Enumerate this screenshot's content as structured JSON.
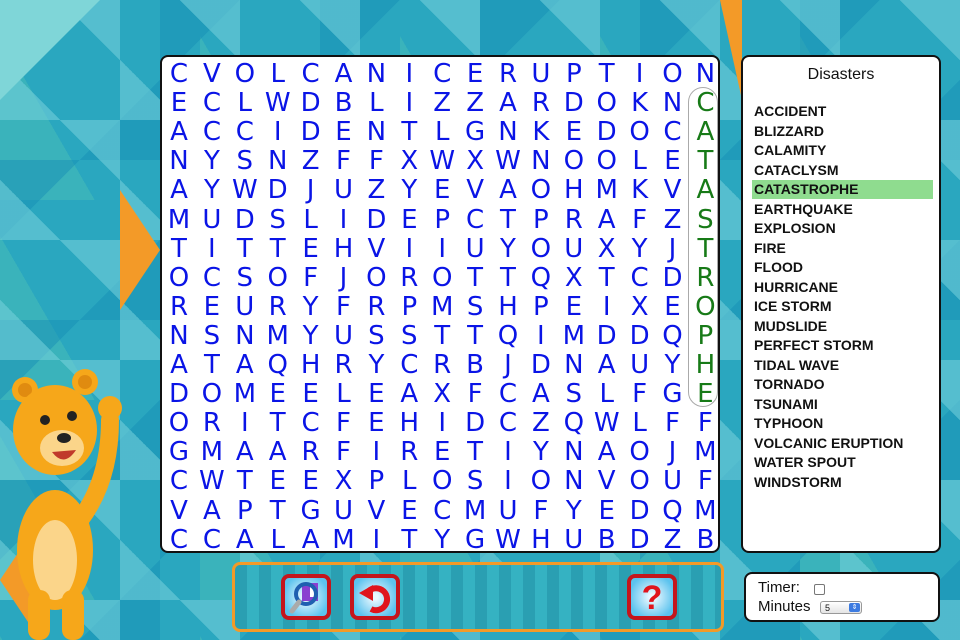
{
  "grid": {
    "rows": [
      "CVOLCANICERUPTION",
      "ECLWDBLIZZARDOKNC",
      "ACCIDENTLGNKEDOCA",
      "NYSNZFFXWXWNOOLET",
      "AYWDJUZYEVAOHMKVA",
      "MUDSLIDEPCTPRAFZS",
      "TITTEHVIIUYOUXYJT",
      "OCSOFJOROTTQXTCDR",
      "REURYFRPMSHPEIXEO",
      "NSNMYUSSTTQIMDDQP",
      "ATAQHRYCRBJDNAUYH",
      "DOMEELEAXFCASLFGE",
      "ORITCFEHIDCZQWLFF",
      "GMAARFIRETIYNAOJM",
      "CWTEEXPLOSIONVOUF",
      "VAPTGUVECMUFYEDQM",
      "CCALAMITYGWHUBDZB"
    ],
    "found_word": "CATASTROPHE",
    "found_color": "#177a17",
    "letter_color": "#0a14e6"
  },
  "word_list": {
    "title": "Disasters",
    "items": [
      {
        "label": "ACCIDENT",
        "found": false
      },
      {
        "label": "BLIZZARD",
        "found": false
      },
      {
        "label": "CALAMITY",
        "found": false
      },
      {
        "label": "CATACLYSM",
        "found": false
      },
      {
        "label": "CATASTROPHE",
        "found": true
      },
      {
        "label": "EARTHQUAKE",
        "found": false
      },
      {
        "label": "EXPLOSION",
        "found": false
      },
      {
        "label": "FIRE",
        "found": false
      },
      {
        "label": "FLOOD",
        "found": false
      },
      {
        "label": "HURRICANE",
        "found": false
      },
      {
        "label": "ICE STORM",
        "found": false
      },
      {
        "label": "MUDSLIDE",
        "found": false
      },
      {
        "label": "PERFECT STORM",
        "found": false
      },
      {
        "label": "TIDAL WAVE",
        "found": false
      },
      {
        "label": "TORNADO",
        "found": false
      },
      {
        "label": "TSUNAMI",
        "found": false
      },
      {
        "label": "TYPHOON",
        "found": false
      },
      {
        "label": "VOLCANIC ERUPTION",
        "found": false
      },
      {
        "label": "WATER SPOUT",
        "found": false
      },
      {
        "label": "WINDSTORM",
        "found": false
      }
    ],
    "highlight_color": "#8fdc8f"
  },
  "toolbar": {
    "buttons": [
      {
        "icon": "magnifier-hint-icon"
      },
      {
        "icon": "undo-arrow-icon"
      },
      {
        "icon": "question-mark-icon"
      }
    ]
  },
  "timer": {
    "label": "Timer:",
    "checked": false,
    "minutes_label": "Minutes",
    "minutes_value": "5"
  }
}
